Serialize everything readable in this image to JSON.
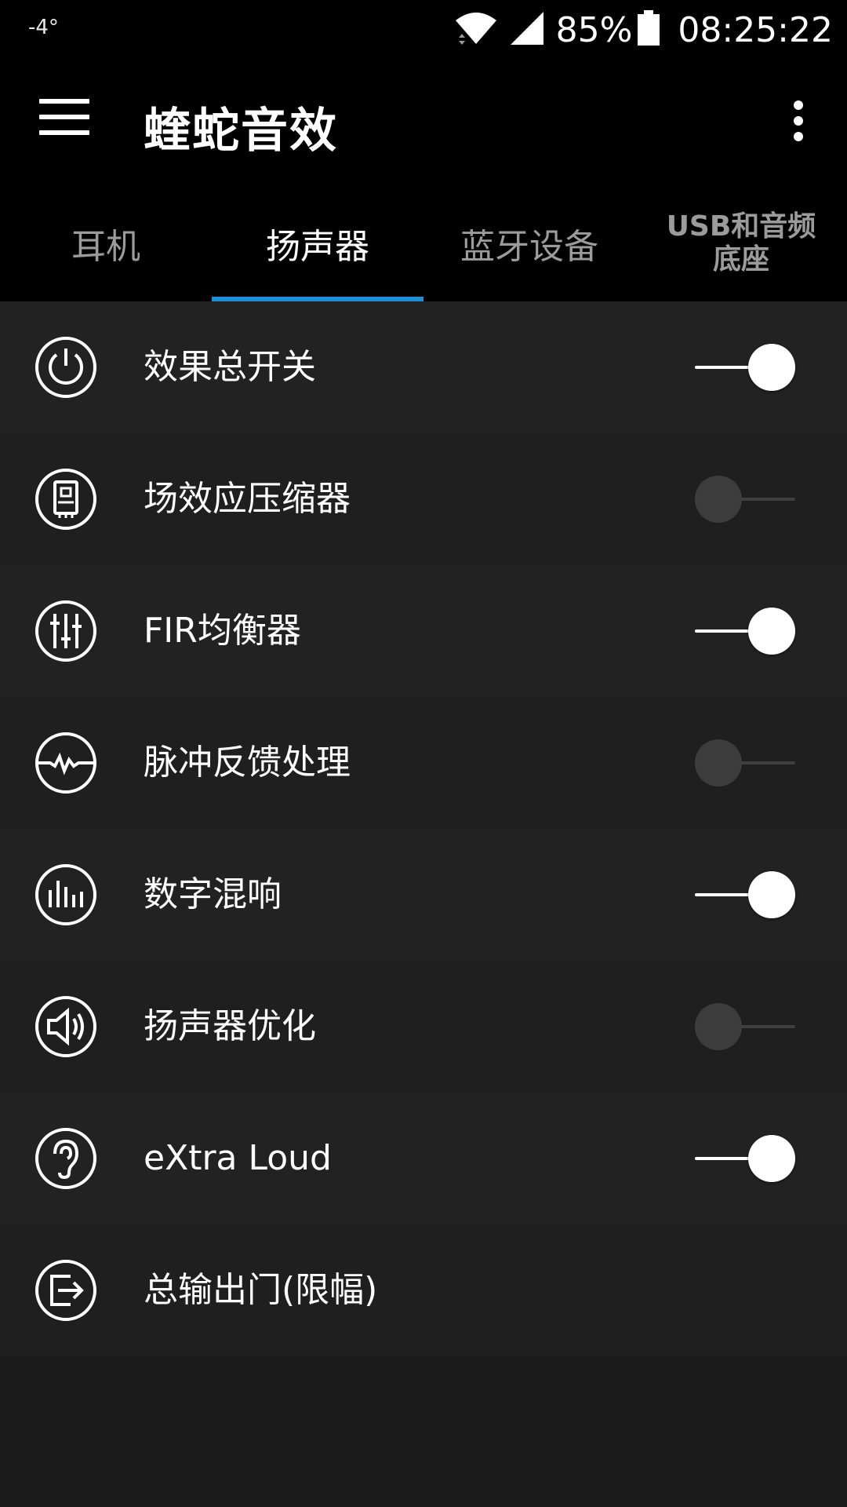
{
  "status_bar": {
    "temperature": "-4°",
    "battery_percent": "85%",
    "time": "08:25:22",
    "icons": [
      "wifi-icon",
      "cell-signal-icon",
      "battery-icon"
    ]
  },
  "app_bar": {
    "title": "蝰蛇音效",
    "icons": [
      "menu-icon",
      "overflow-menu-icon"
    ]
  },
  "tabs": [
    {
      "label": "耳机",
      "active": false
    },
    {
      "label": "扬声器",
      "active": true
    },
    {
      "label": "蓝牙设备",
      "active": false
    },
    {
      "label": "USB和音频底座",
      "line1": "USB和音频",
      "line2": "底座",
      "active": false
    }
  ],
  "accent_color": "#1e8fd6",
  "items": [
    {
      "label": "效果总开关",
      "icon": "power-icon",
      "toggle": true
    },
    {
      "label": "场效应压缩器",
      "icon": "compressor-icon",
      "toggle": false
    },
    {
      "label": "FIR均衡器",
      "icon": "equalizer-sliders-icon",
      "toggle": true
    },
    {
      "label": "脉冲反馈处理",
      "icon": "pulse-wave-icon",
      "toggle": false
    },
    {
      "label": "数字混响",
      "icon": "reverb-bars-icon",
      "toggle": true
    },
    {
      "label": "扬声器优化",
      "icon": "speaker-icon",
      "toggle": false
    },
    {
      "label": "eXtra Loud",
      "icon": "ear-icon",
      "toggle": true
    },
    {
      "label": "总输出门(限幅)",
      "icon": "output-gate-icon",
      "toggle": null
    }
  ]
}
